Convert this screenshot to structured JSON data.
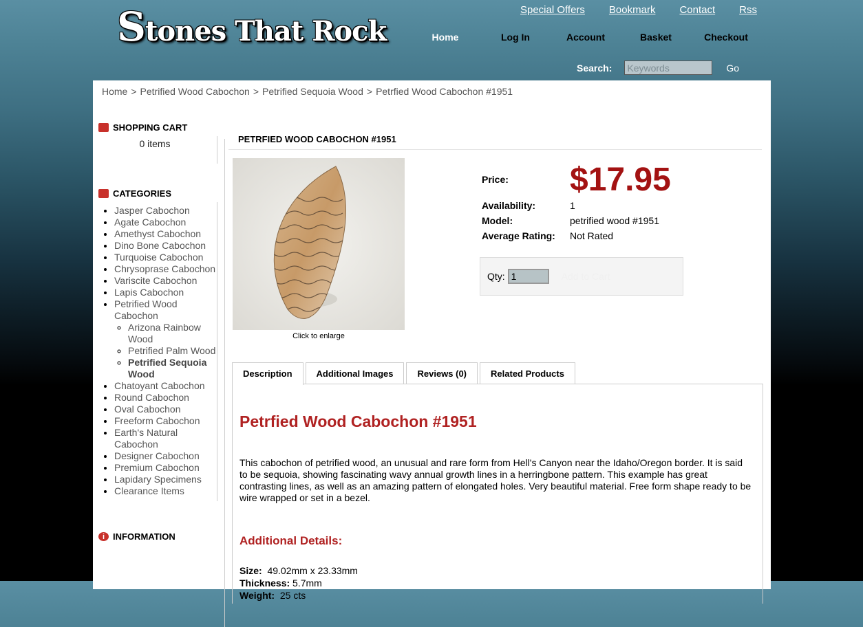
{
  "header": {
    "logo_first": "S",
    "logo_rest": "tones That Rock",
    "top_links": [
      "Special Offers",
      "Bookmark",
      "Contact",
      "Rss"
    ],
    "nav": [
      "Home",
      "Log In",
      "Account",
      "Basket",
      "Checkout"
    ],
    "search_label": "Search:",
    "search_placeholder": "Keywords",
    "search_go": "Go"
  },
  "breadcrumb": [
    "Home",
    "Petrified Wood Cabochon",
    "Petrified Sequoia Wood",
    "Petrfied Wood Cabochon #1951"
  ],
  "breadcrumb_sep": ">",
  "sidebar": {
    "cart_title": "SHOPPING CART",
    "cart_items": "0 items",
    "categories_title": "CATEGORIES",
    "categories": [
      "Jasper Cabochon",
      "Agate Cabochon",
      "Amethyst Cabochon",
      "Dino Bone Cabochon",
      "Turquoise Cabochon",
      "Chrysoprase Cabochon",
      "Variscite Cabochon",
      "Lapis Cabochon",
      "Petrified Wood Cabochon"
    ],
    "subcategories": [
      "Arizona Rainbow Wood",
      "Petrified Palm Wood",
      "Petrified Sequoia Wood"
    ],
    "categories_after": [
      "Chatoyant Cabochon",
      "Round Cabochon",
      "Oval Cabochon",
      "Freeform Cabochon",
      "Earth's Natural Cabochon",
      "Designer Cabochon",
      "Premium Cabochon",
      "Lapidary Specimens",
      "Clearance Items"
    ],
    "info_title": "INFORMATION"
  },
  "product": {
    "title": "PETRFIED WOOD CABOCHON #1951",
    "enlarge": "Click to enlarge",
    "price_label": "Price:",
    "price": "$17.95",
    "availability_label": "Availability:",
    "availability": "1",
    "model_label": "Model:",
    "model": "petrified wood #1951",
    "rating_label": "Average Rating:",
    "rating": "Not Rated",
    "qty_label": "Qty:",
    "qty_value": "1",
    "add_to_cart": "Add to Cart"
  },
  "tabs": [
    "Description",
    "Additional Images",
    "Reviews (0)",
    "Related Products"
  ],
  "description": {
    "heading": "Petrfied Wood Cabochon #1951",
    "text": "This cabochon of petrified wood, an unusual and rare form from Hell's Canyon near the Idaho/Oregon border. It is said to be sequoia, showing fascinating wavy annual growth lines in a herringbone pattern. This example has great contrasting lines, as well as an amazing pattern of elongated holes. Very beautiful material. Free form shape ready to be wire wrapped or set in a bezel.",
    "details_heading": "Additional Details:",
    "size_label": "Size:",
    "size": "49.02mm x 23.33mm",
    "thickness_label": "Thickness:",
    "thickness": "5.7mm",
    "weight_label": "Weight:",
    "weight": "25 cts"
  }
}
